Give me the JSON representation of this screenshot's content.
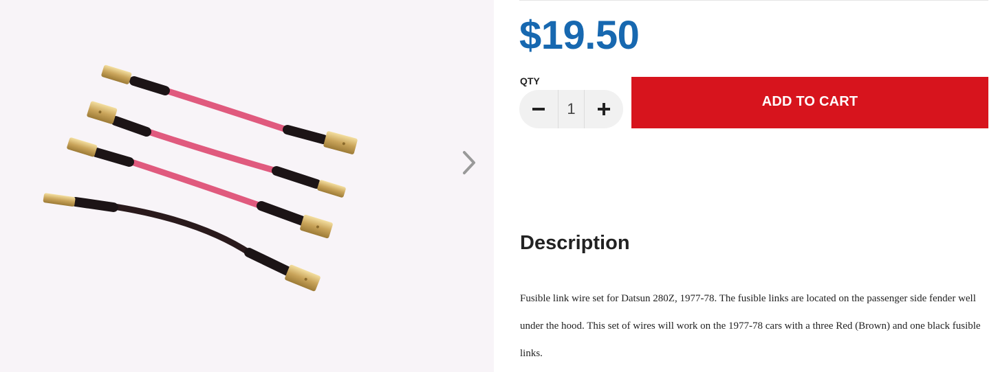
{
  "product": {
    "price": "$19.50",
    "quantity": {
      "label": "QTY",
      "value": "1",
      "decrement_icon": "minus-icon",
      "increment_icon": "plus-icon"
    },
    "add_to_cart_label": "ADD TO CART",
    "description": {
      "heading": "Description",
      "body": "Fusible link wire set for Datsun 280Z, 1977-78. The fusible links are located on the passenger side fender well under the hood. This set of wires will work on the 1977-78 cars with a three Red (Brown) and one black fusible links."
    }
  },
  "gallery": {
    "next_icon": "chevron-right-icon",
    "wire_colors": [
      "#e05a7e",
      "#e05a7e",
      "#e05a7e",
      "#2a1a1c"
    ]
  },
  "colors": {
    "price": "#1768b0",
    "add_to_cart": "#d7141d",
    "stepper_background": "#f1f1f1"
  }
}
